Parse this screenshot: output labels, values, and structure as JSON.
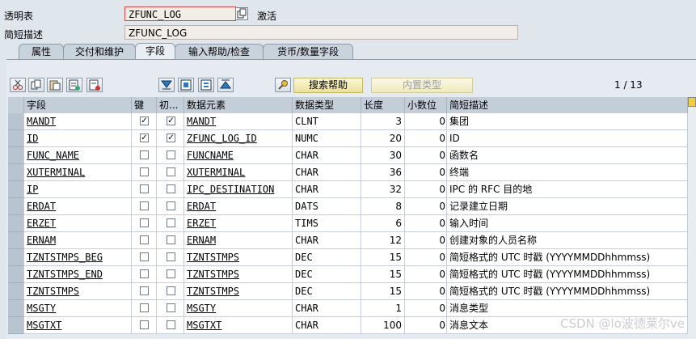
{
  "header": {
    "table_label": "透明表",
    "table_name": "ZFUNC_LOG",
    "status": "激活",
    "desc_label": "简短描述",
    "desc_value": "ZFUNC_LOG"
  },
  "tabs": [
    {
      "label": "属性"
    },
    {
      "label": "交付和维护"
    },
    {
      "label": "字段"
    },
    {
      "label": "输入帮助/检查"
    },
    {
      "label": "货币/数量字段"
    }
  ],
  "toolbar": {
    "search_help_label": "搜索帮助",
    "builtin_type_label": "内置类型",
    "pager": "1 / 13"
  },
  "columns": {
    "field": "字段",
    "key": "键",
    "init": "初...",
    "data_element": "数据元素",
    "data_type": "数据类型",
    "length": "长度",
    "decimals": "小数位",
    "short_desc": "简短描述"
  },
  "rows": [
    {
      "field": "MANDT",
      "key": true,
      "init": true,
      "de": "MANDT",
      "type": "CLNT",
      "len": "3",
      "dec": "0",
      "desc": "集团"
    },
    {
      "field": "ID",
      "key": true,
      "init": true,
      "de": "ZFUNC_LOG_ID",
      "type": "NUMC",
      "len": "20",
      "dec": "0",
      "desc": "ID"
    },
    {
      "field": "FUNC_NAME",
      "key": false,
      "init": false,
      "de": "FUNCNAME",
      "type": "CHAR",
      "len": "30",
      "dec": "0",
      "desc": "函数名"
    },
    {
      "field": "XUTERMINAL",
      "key": false,
      "init": false,
      "de": "XUTERMINAL",
      "type": "CHAR",
      "len": "36",
      "dec": "0",
      "desc": "终端"
    },
    {
      "field": "IP",
      "key": false,
      "init": false,
      "de": "IPC_DESTINATION",
      "type": "CHAR",
      "len": "32",
      "dec": "0",
      "desc": "IPC 的 RFC 目的地"
    },
    {
      "field": "ERDAT",
      "key": false,
      "init": false,
      "de": "ERDAT",
      "type": "DATS",
      "len": "8",
      "dec": "0",
      "desc": "记录建立日期"
    },
    {
      "field": "ERZET",
      "key": false,
      "init": false,
      "de": "ERZET",
      "type": "TIMS",
      "len": "6",
      "dec": "0",
      "desc": "输入时间"
    },
    {
      "field": "ERNAM",
      "key": false,
      "init": false,
      "de": "ERNAM",
      "type": "CHAR",
      "len": "12",
      "dec": "0",
      "desc": "创建对象的人员名称"
    },
    {
      "field": "TZNTSTMPS_BEG",
      "key": false,
      "init": false,
      "de": "TZNTSTMPS",
      "type": "DEC",
      "len": "15",
      "dec": "0",
      "desc": "简短格式的 UTC 时戳 (YYYYMMDDhhmmss)"
    },
    {
      "field": "TZNTSTMPS_END",
      "key": false,
      "init": false,
      "de": "TZNTSTMPS",
      "type": "DEC",
      "len": "15",
      "dec": "0",
      "desc": "简短格式的 UTC 时戳 (YYYYMMDDhhmmss)"
    },
    {
      "field": "TZNTSTMPS",
      "key": false,
      "init": false,
      "de": "TZNTSTMPS",
      "type": "DEC",
      "len": "15",
      "dec": "0",
      "desc": "简短格式的 UTC 时戳 (YYYYMMDDhhmmss)"
    },
    {
      "field": "MSGTY",
      "key": false,
      "init": false,
      "de": "MSGTY",
      "type": "CHAR",
      "len": "1",
      "dec": "0",
      "desc": "消息类型"
    },
    {
      "field": "MSGTXT",
      "key": false,
      "init": false,
      "de": "MSGTXT",
      "type": "CHAR",
      "len": "100",
      "dec": "0",
      "desc": "消息文本"
    }
  ],
  "watermark": "CSDN @lo波德莱尔ve"
}
